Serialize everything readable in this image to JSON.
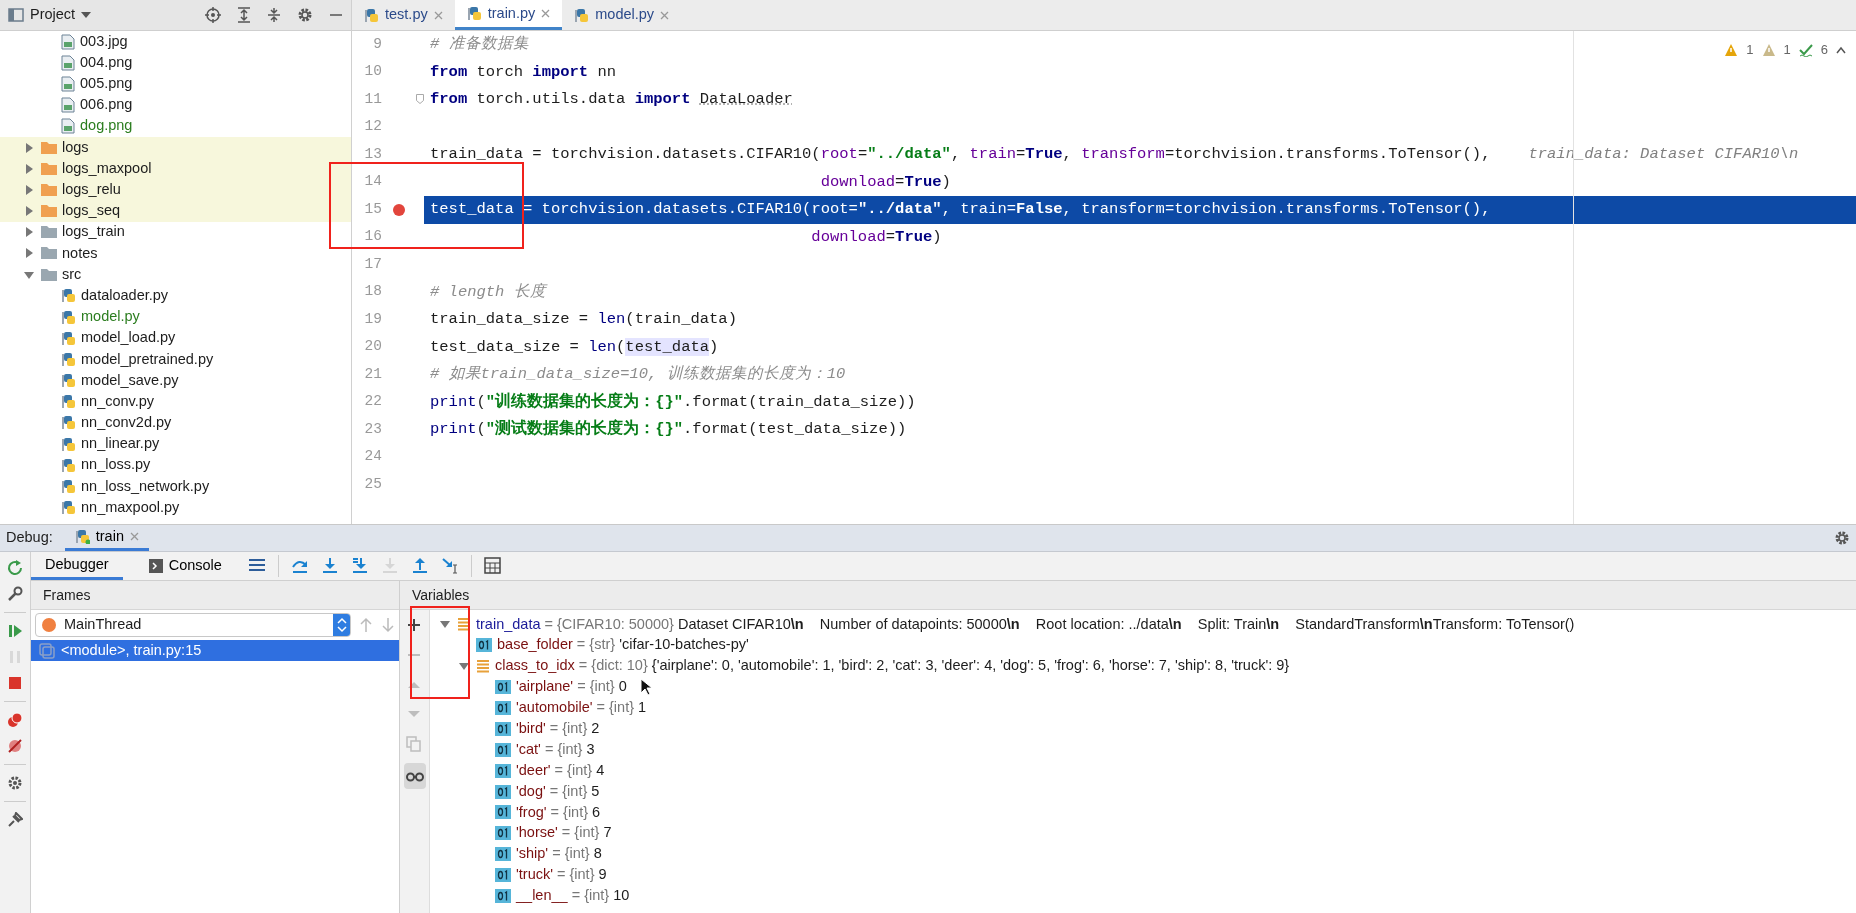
{
  "project": {
    "title": "Project",
    "image_files": [
      {
        "label": "003.jpg",
        "new": false
      },
      {
        "label": "004.png",
        "new": false
      },
      {
        "label": "005.png",
        "new": false
      },
      {
        "label": "006.png",
        "new": false
      },
      {
        "label": "dog.png",
        "new": true
      }
    ],
    "tree": [
      {
        "label": "logs",
        "kind": "folder",
        "excluded": true,
        "expanded": false
      },
      {
        "label": "logs_maxpool",
        "kind": "folder",
        "excluded": true,
        "expanded": false
      },
      {
        "label": "logs_relu",
        "kind": "folder",
        "excluded": true,
        "expanded": false
      },
      {
        "label": "logs_seq",
        "kind": "folder",
        "excluded": true,
        "expanded": false
      },
      {
        "label": "logs_train",
        "kind": "folder",
        "excluded": false,
        "expanded": false
      },
      {
        "label": "notes",
        "kind": "folder",
        "excluded": false,
        "expanded": false
      },
      {
        "label": "src",
        "kind": "folder",
        "excluded": false,
        "expanded": true,
        "children": [
          {
            "label": "dataloader.py",
            "kind": "python",
            "new": false
          },
          {
            "label": "model.py",
            "kind": "python",
            "new": true
          },
          {
            "label": "model_load.py",
            "kind": "python",
            "new": false
          },
          {
            "label": "model_pretrained.py",
            "kind": "python",
            "new": false
          },
          {
            "label": "model_save.py",
            "kind": "python",
            "new": false
          },
          {
            "label": "nn_conv.py",
            "kind": "python",
            "new": false
          },
          {
            "label": "nn_conv2d.py",
            "kind": "python",
            "new": false
          },
          {
            "label": "nn_linear.py",
            "kind": "python",
            "new": false
          },
          {
            "label": "nn_loss.py",
            "kind": "python",
            "new": false
          },
          {
            "label": "nn_loss_network.py",
            "kind": "python",
            "new": false
          },
          {
            "label": "nn_maxpool.py",
            "kind": "python",
            "new": false
          }
        ]
      }
    ]
  },
  "editor_tabs": [
    {
      "label": "test.py",
      "selected": false
    },
    {
      "label": "train.py",
      "selected": true
    },
    {
      "label": "model.py",
      "selected": false
    }
  ],
  "editor": {
    "inspections": [
      {
        "kind": "warning",
        "count": "1"
      },
      {
        "kind": "weak-warning",
        "count": "1"
      },
      {
        "kind": "typo",
        "count": "6"
      }
    ],
    "lines": [
      {
        "number": "9",
        "breakpoint": false,
        "selected": false,
        "fold": false,
        "tokens": [
          {
            "kind": "comment",
            "s": "# 准备数据集"
          }
        ]
      },
      {
        "number": "10",
        "breakpoint": false,
        "selected": false,
        "fold": false,
        "tokens": [
          {
            "kind": "kw",
            "s": "from"
          },
          {
            "kind": "plain",
            "s": " torch "
          },
          {
            "kind": "kw",
            "s": "import"
          },
          {
            "kind": "plain",
            "s": " nn"
          }
        ]
      },
      {
        "number": "11",
        "breakpoint": false,
        "selected": false,
        "fold": true,
        "tokens": [
          {
            "kind": "kw",
            "s": "from"
          },
          {
            "kind": "plain",
            "s": " torch.utils.data "
          },
          {
            "kind": "kw",
            "s": "import "
          },
          {
            "kind": "weak",
            "s": "DataLoader"
          }
        ]
      },
      {
        "number": "12",
        "breakpoint": false,
        "selected": false,
        "fold": false
      },
      {
        "number": "13",
        "breakpoint": false,
        "selected": false,
        "fold": false,
        "hint": "train_data: Dataset CIFAR10\\n",
        "tokens": [
          {
            "kind": "plain",
            "s": "train_data = torchvision.datasets.CIFAR10("
          },
          {
            "kind": "param",
            "s": "root"
          },
          {
            "kind": "plain",
            "s": "="
          },
          {
            "kind": "str",
            "s": "\"../data\""
          },
          {
            "kind": "plain",
            "s": ", "
          },
          {
            "kind": "param",
            "s": "train"
          },
          {
            "kind": "plain",
            "s": "="
          },
          {
            "kind": "kw",
            "s": "True"
          },
          {
            "kind": "plain",
            "s": ", "
          },
          {
            "kind": "param",
            "s": "transform"
          },
          {
            "kind": "plain",
            "s": "=torchvision.transforms.ToTensor(),"
          }
        ]
      },
      {
        "number": "14",
        "breakpoint": false,
        "selected": false,
        "fold": false,
        "tokens": [
          {
            "kind": "param",
            "s": "                                          download"
          },
          {
            "kind": "plain",
            "s": "="
          },
          {
            "kind": "kw",
            "s": "True"
          },
          {
            "kind": "plain",
            "s": ")"
          }
        ]
      },
      {
        "number": "15",
        "breakpoint": true,
        "selected": true,
        "fold": false,
        "tokens": [
          {
            "kind": "plain",
            "s": "test_data = torchvision.datasets.CIFAR10("
          },
          {
            "kind": "param",
            "s": "root"
          },
          {
            "kind": "plain",
            "s": "="
          },
          {
            "kind": "str",
            "s": "\"../data\""
          },
          {
            "kind": "plain",
            "s": ", "
          },
          {
            "kind": "param",
            "s": "train"
          },
          {
            "kind": "plain",
            "s": "="
          },
          {
            "kind": "kw",
            "s": "False"
          },
          {
            "kind": "plain",
            "s": ", "
          },
          {
            "kind": "param",
            "s": "transform"
          },
          {
            "kind": "plain",
            "s": "=torchvision.transforms.ToTensor(),"
          }
        ]
      },
      {
        "number": "16",
        "breakpoint": false,
        "selected": false,
        "fold": false,
        "tokens": [
          {
            "kind": "param",
            "s": "                                         download"
          },
          {
            "kind": "plain",
            "s": "="
          },
          {
            "kind": "kw",
            "s": "True"
          },
          {
            "kind": "plain",
            "s": ")"
          }
        ]
      },
      {
        "number": "17",
        "breakpoint": false,
        "selected": false,
        "fold": false
      },
      {
        "number": "18",
        "breakpoint": false,
        "selected": false,
        "fold": false,
        "tokens": [
          {
            "kind": "comment",
            "s": "# length 长度"
          }
        ]
      },
      {
        "number": "19",
        "breakpoint": false,
        "selected": false,
        "fold": false,
        "tokens": [
          {
            "kind": "plain",
            "s": "train_data_size = "
          },
          {
            "kind": "builtin",
            "s": "len"
          },
          {
            "kind": "plain",
            "s": "(train_data)"
          }
        ]
      },
      {
        "number": "20",
        "breakpoint": false,
        "selected": false,
        "fold": false,
        "tokens": [
          {
            "kind": "plain",
            "s": "test_data_size = "
          },
          {
            "kind": "builtin",
            "s": "len"
          },
          {
            "kind": "plain",
            "s": "("
          },
          {
            "kind": "usage",
            "s": "test_data"
          },
          {
            "kind": "plain",
            "s": ")"
          }
        ]
      },
      {
        "number": "21",
        "breakpoint": false,
        "selected": false,
        "fold": false,
        "tokens": [
          {
            "kind": "comment",
            "s": "# 如果train_data_size=10, 训练数据集的长度为：10"
          }
        ]
      },
      {
        "number": "22",
        "breakpoint": false,
        "selected": false,
        "fold": false,
        "tokens": [
          {
            "kind": "builtin",
            "s": "print"
          },
          {
            "kind": "plain",
            "s": "("
          },
          {
            "kind": "str",
            "s": "\"训练数据集的长度为：{}\""
          },
          {
            "kind": "plain",
            "s": ".format(train_data_size))"
          }
        ]
      },
      {
        "number": "23",
        "breakpoint": false,
        "selected": false,
        "fold": false,
        "tokens": [
          {
            "kind": "builtin",
            "s": "print"
          },
          {
            "kind": "plain",
            "s": "("
          },
          {
            "kind": "str",
            "s": "\"测试数据集的长度为：{}\""
          },
          {
            "kind": "plain",
            "s": ".format(test_data_size))"
          }
        ]
      },
      {
        "number": "24",
        "breakpoint": false,
        "selected": false,
        "fold": false
      },
      {
        "number": "25",
        "breakpoint": false,
        "selected": false,
        "fold": false
      }
    ]
  },
  "debug": {
    "label": "Debug:",
    "sessions": [
      {
        "label": "train",
        "selected": true
      }
    ],
    "side_tools": [
      {
        "kind": "rerun",
        "disabled": false
      },
      {
        "kind": "wrench",
        "disabled": false
      },
      {
        "kind": "separator"
      },
      {
        "kind": "resume",
        "disabled": false
      },
      {
        "kind": "pause",
        "disabled": true
      },
      {
        "kind": "stop",
        "disabled": false
      },
      {
        "kind": "separator"
      },
      {
        "kind": "breakpoints",
        "disabled": false
      },
      {
        "kind": "mute",
        "disabled": false
      },
      {
        "kind": "separator"
      },
      {
        "kind": "settings",
        "disabled": false
      },
      {
        "kind": "separator"
      },
      {
        "kind": "pin",
        "disabled": false
      }
    ],
    "tabs": [
      {
        "label": "Debugger",
        "kind": "plain",
        "selected": true
      },
      {
        "label": "Console",
        "kind": "console",
        "selected": false
      }
    ],
    "tools": [
      {
        "kind": "lines",
        "disabled": false
      },
      {
        "kind": "separator"
      },
      {
        "kind": "step-over",
        "disabled": false
      },
      {
        "kind": "step-into",
        "disabled": false
      },
      {
        "kind": "step-into-mine",
        "disabled": false
      },
      {
        "kind": "force-step",
        "disabled": true
      },
      {
        "kind": "step-out",
        "disabled": false
      },
      {
        "kind": "run-cursor",
        "disabled": false
      },
      {
        "kind": "separator"
      },
      {
        "kind": "evaluate",
        "disabled": false
      }
    ],
    "frames": {
      "title": "Frames",
      "thread": "MainThread",
      "items": [
        {
          "label": "<module>, train.py:15",
          "selected": true
        }
      ]
    },
    "variables": {
      "title": "Variables",
      "tools": [
        {
          "kind": "add",
          "disabled": false,
          "selected": false
        },
        {
          "kind": "remove",
          "disabled": true,
          "selected": false
        },
        {
          "kind": "up",
          "disabled": true,
          "selected": false
        },
        {
          "kind": "down",
          "disabled": true,
          "selected": false
        },
        {
          "kind": "copy",
          "disabled": true,
          "selected": false
        },
        {
          "kind": "glasses",
          "disabled": false,
          "selected": true
        }
      ],
      "items": [
        {
          "name": "train_data",
          "type": "= {CIFAR10: 50000}",
          "value": "Dataset CIFAR10**\\n**    Number of datapoints: 50000**\\n**    Root location: ../data**\\n**    Split: Train**\\n**    StandardTransform**\\n**Transform: ToTensor()",
          "kind": "object",
          "expanded": true,
          "children": [
            {
              "name": "base_folder",
              "type": "= {str}",
              "value": "'cifar-10-batches-py'",
              "kind": "primitive"
            },
            {
              "name": "class_to_idx",
              "type": "= {dict: 10}",
              "value": "{'airplane': 0, 'automobile': 1, 'bird': 2, 'cat': 3, 'deer': 4, 'dog': 5, 'frog': 6, 'horse': 7, 'ship': 8, 'truck': 9}",
              "kind": "object",
              "expanded": true,
              "children": [
                {
                  "name": "'airplane'",
                  "type": "= {int}",
                  "value": "0",
                  "kind": "primitive"
                },
                {
                  "name": "'automobile'",
                  "type": "= {int}",
                  "value": "1",
                  "kind": "primitive"
                },
                {
                  "name": "'bird'",
                  "type": "= {int}",
                  "value": "2",
                  "kind": "primitive"
                },
                {
                  "name": "'cat'",
                  "type": "= {int}",
                  "value": "3",
                  "kind": "primitive"
                },
                {
                  "name": "'deer'",
                  "type": "= {int}",
                  "value": "4",
                  "kind": "primitive"
                },
                {
                  "name": "'dog'",
                  "type": "= {int}",
                  "value": "5",
                  "kind": "primitive"
                },
                {
                  "name": "'frog'",
                  "type": "= {int}",
                  "value": "6",
                  "kind": "primitive"
                },
                {
                  "name": "'horse'",
                  "type": "= {int}",
                  "value": "7",
                  "kind": "primitive"
                },
                {
                  "name": "'ship'",
                  "type": "= {int}",
                  "value": "8",
                  "kind": "primitive"
                },
                {
                  "name": "'truck'",
                  "type": "= {int}",
                  "value": "9",
                  "kind": "primitive"
                },
                {
                  "name": "__len__",
                  "type": "= {int}",
                  "value": "10",
                  "kind": "primitive"
                }
              ]
            }
          ]
        }
      ]
    }
  }
}
